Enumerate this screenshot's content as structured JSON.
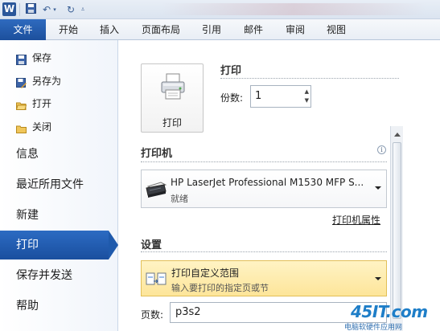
{
  "titlebar": {
    "app_logo_letter": "W"
  },
  "tabs": [
    {
      "label": "文件"
    },
    {
      "label": "开始"
    },
    {
      "label": "插入"
    },
    {
      "label": "页面布局"
    },
    {
      "label": "引用"
    },
    {
      "label": "邮件"
    },
    {
      "label": "审阅"
    },
    {
      "label": "视图"
    }
  ],
  "nav": {
    "small": [
      {
        "label": "保存",
        "icon": "save-icon"
      },
      {
        "label": "另存为",
        "icon": "save-as-icon"
      },
      {
        "label": "打开",
        "icon": "open-folder-icon"
      },
      {
        "label": "关闭",
        "icon": "close-folder-icon"
      }
    ],
    "big": [
      {
        "label": "信息"
      },
      {
        "label": "最近所用文件"
      },
      {
        "label": "新建"
      },
      {
        "label": "打印"
      },
      {
        "label": "保存并发送"
      },
      {
        "label": "帮助"
      }
    ]
  },
  "print": {
    "button_label": "打印",
    "section_title": "打印",
    "copies_label": "份数:",
    "copies_value": "1"
  },
  "printer": {
    "section_title": "打印机",
    "name": "HP LaserJet Professional M1530 MFP S...",
    "status": "就绪",
    "properties_link": "打印机属性"
  },
  "settings": {
    "section_title": "设置",
    "range_title": "打印自定义范围",
    "range_subtitle": "输入要打印的指定页或节",
    "pages_label": "页数:",
    "pages_value": "p3s2"
  },
  "watermark": {
    "main": "45IT.com",
    "sub": "电脑软硬件应用网"
  },
  "colors": {
    "accent": "#1f5aac",
    "highlight": "#fde59a"
  }
}
